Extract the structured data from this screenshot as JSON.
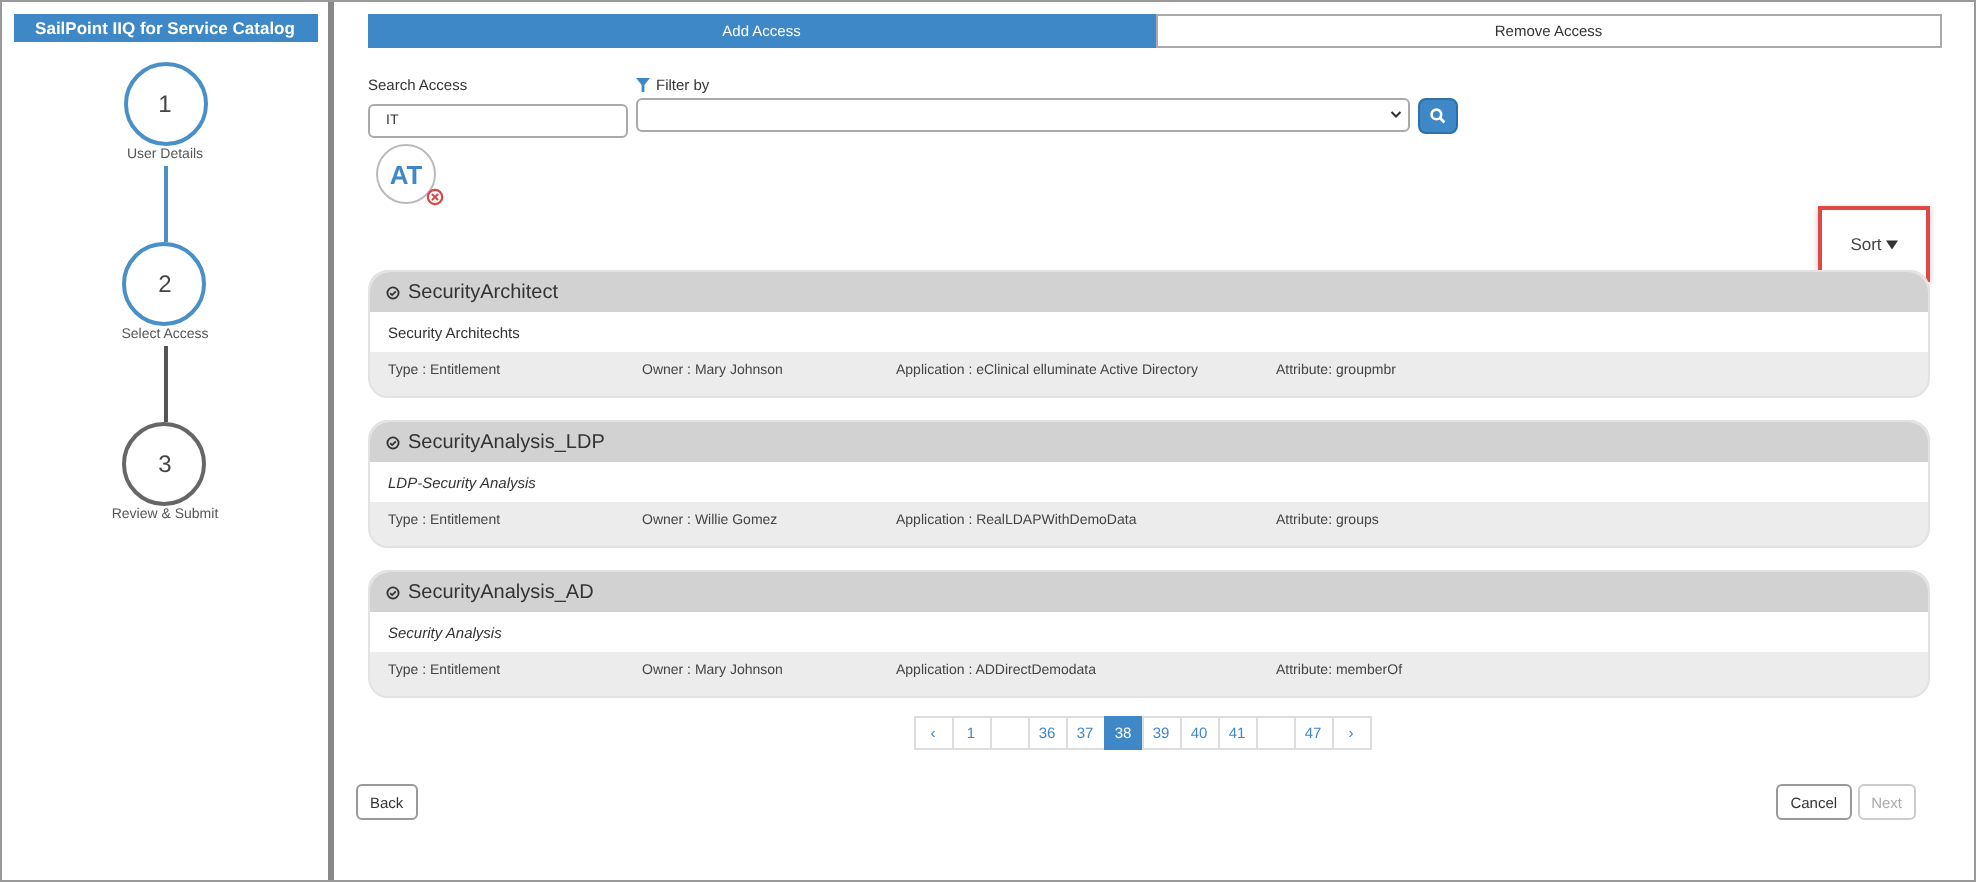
{
  "sidebar": {
    "title": "SailPoint IIQ for Service Catalog",
    "steps": [
      {
        "number": "1",
        "label": "User Details",
        "active": true
      },
      {
        "number": "2",
        "label": "Select Access",
        "active": true
      },
      {
        "number": "3",
        "label": "Review & Submit",
        "active": false
      }
    ]
  },
  "tabs": [
    {
      "label": "Add Access",
      "selected": true
    },
    {
      "label": "Remove Access",
      "selected": false
    }
  ],
  "search": {
    "label": "Search Access",
    "value": "IT"
  },
  "filter": {
    "label": "Filter by"
  },
  "selected_chips": [
    {
      "initials": "AT"
    }
  ],
  "sort": {
    "label": "Sort",
    "highlighted": true
  },
  "results": [
    {
      "name": "SecurityArchitect",
      "description": "Security Architechts",
      "italic": false,
      "type": "Type : Entitlement",
      "owner": "Owner : Mary Johnson",
      "application": "Application : eClinical elluminate Active Directory",
      "attribute": "Attribute: groupmbr"
    },
    {
      "name": "SecurityAnalysis_LDP",
      "description": "LDP-Security Analysis",
      "italic": true,
      "type": "Type : Entitlement",
      "owner": "Owner : Willie Gomez",
      "application": "Application : RealLDAPWithDemoData",
      "attribute": "Attribute: groups"
    },
    {
      "name": "SecurityAnalysis_AD",
      "description": "Security Analysis",
      "italic": true,
      "type": "Type : Entitlement",
      "owner": "Owner : Mary Johnson",
      "application": "Application : ADDirectDemodata",
      "attribute": "Attribute: memberOf"
    }
  ],
  "pagination": [
    {
      "kind": "page",
      "label": "‹",
      "selected": false
    },
    {
      "kind": "page",
      "label": "1",
      "selected": false
    },
    {
      "kind": "gap"
    },
    {
      "kind": "page",
      "label": "36",
      "selected": false
    },
    {
      "kind": "page",
      "label": "37",
      "selected": false
    },
    {
      "kind": "page",
      "label": "38",
      "selected": true
    },
    {
      "kind": "page",
      "label": "39",
      "selected": false
    },
    {
      "kind": "page",
      "label": "40",
      "selected": false
    },
    {
      "kind": "page",
      "label": "41",
      "selected": false
    },
    {
      "kind": "gap"
    },
    {
      "kind": "page",
      "label": "47",
      "selected": false
    },
    {
      "kind": "page",
      "label": "›",
      "selected": false
    }
  ],
  "footer": {
    "back": {
      "label": "Back",
      "disabled": false
    },
    "cancel": {
      "label": "Cancel",
      "disabled": false
    },
    "next": {
      "label": "Next",
      "disabled": true
    }
  }
}
